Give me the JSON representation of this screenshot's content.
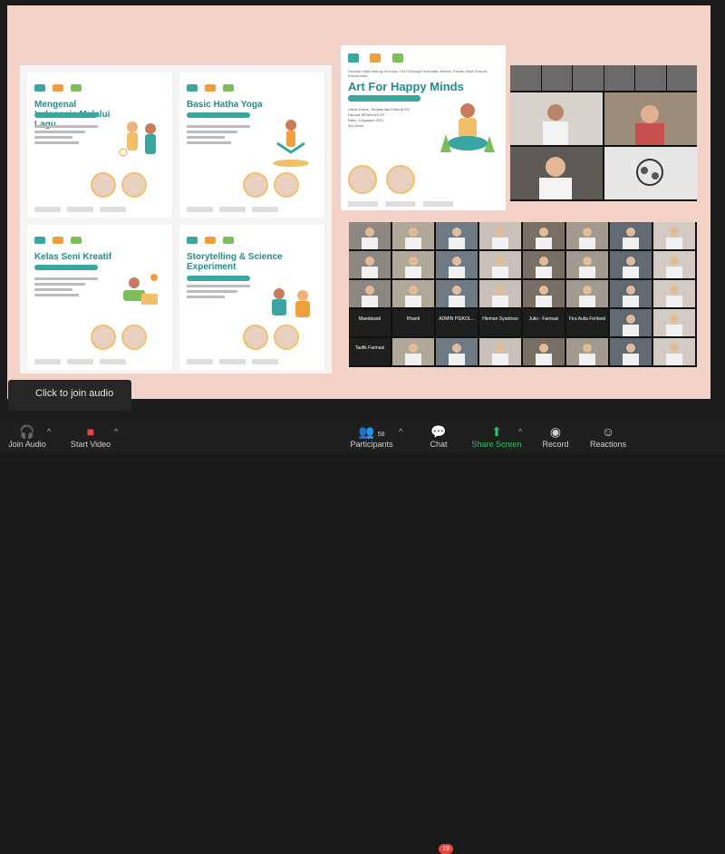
{
  "tooltip": {
    "text": "Click to join audio"
  },
  "toolbar": {
    "join_audio": "Join Audio",
    "start_video": "Start Video",
    "participants": "Participants",
    "participants_count": "58",
    "chat": "Chat",
    "chat_badge": "19",
    "share_screen": "Share Screen",
    "record": "Record",
    "reactions": "Reactions"
  },
  "posters": [
    {
      "title": "Mengenal Indonesia Melalui Lagu"
    },
    {
      "title": "Basic Hatha Yoga"
    },
    {
      "title": "Kelas Seni Kreatif"
    },
    {
      "title": "Storytelling & Science Experiment"
    }
  ],
  "feature_poster": {
    "title": "Art For Happy Minds",
    "kicker": "Gerakan Mari berbagi Seni dan Tim Psikologi Kesehatan Mental, Pamah Sakit Darurat Wisma Atlet",
    "meta": "Untuk Nakes, Tentara dan Polisi di RS Darurat WISMA ATLET",
    "date": "Rabu, 4 Agustus 2021",
    "venue": "Via Zoom"
  },
  "gallery_names": [
    "Maedawati",
    "Khanti",
    "ADMIN PSIKOL...",
    "Hieman Syantoso",
    "Julio - Farmasi",
    "Fira Aulia Ferlianti",
    "Taufik Farmasi"
  ],
  "colors": {
    "accent": "#1d8f8f",
    "share": "#2dbf63",
    "badge": "#e8453c",
    "canvas": "#f3d3c8"
  }
}
